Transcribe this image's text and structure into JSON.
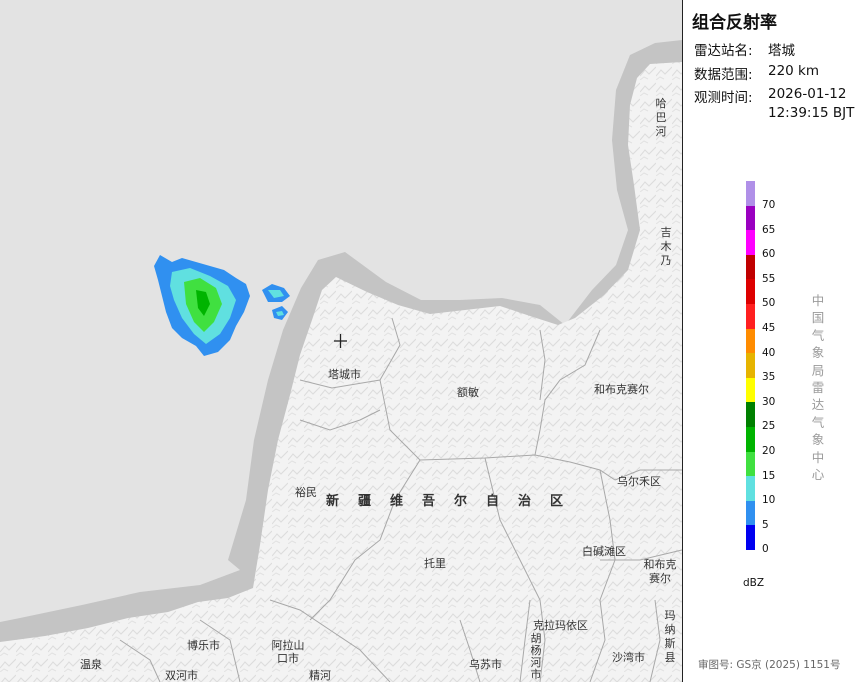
{
  "panel": {
    "title": "组合反射率",
    "station_label": "雷达站名:",
    "station_value": "塔城",
    "range_label": "数据范围:",
    "range_value": "220 km",
    "time_label": "观测时间:",
    "time_date": "2026-01-12",
    "time_clock": "12:39:15 BJT"
  },
  "legend": {
    "unit": "dBZ",
    "labels": [
      "70",
      "65",
      "60",
      "55",
      "50",
      "45",
      "40",
      "35",
      "30",
      "25",
      "20",
      "15",
      "10",
      "5",
      "0"
    ],
    "colors": [
      "#b090e8",
      "#9a00c0",
      "#ff00ff",
      "#c00000",
      "#dd0000",
      "#ff2020",
      "#ff8c00",
      "#e6b400",
      "#ffff00",
      "#008000",
      "#00b400",
      "#40e040",
      "#60e0e0",
      "#3090f0",
      "#0000f0"
    ]
  },
  "agency": "中国气象局雷达气象中心",
  "approval": "审图号: GS京 (2025) 1151号",
  "map": {
    "places": [
      "哈巴河",
      "吉木乃",
      "塔城市",
      "额敏",
      "和布克赛尔",
      "裕民",
      "乌尔禾区",
      "白碱滩区",
      "托里",
      "和布克赛尔",
      "博乐市",
      "阿拉山口市",
      "精河",
      "温泉",
      "双河市",
      "乌苏市",
      "克拉玛依区",
      "胡杨河市",
      "沙湾市",
      "玛纳斯县"
    ],
    "region": "新疆维吾尔自治区",
    "station_marker": "+"
  }
}
